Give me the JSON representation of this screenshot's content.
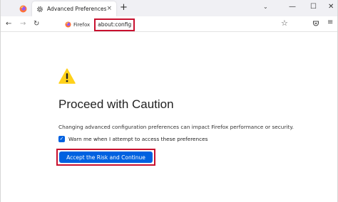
{
  "browser": {
    "tab": {
      "title": "Advanced Preferences",
      "close_glyph": "×"
    },
    "new_tab_glyph": "+",
    "tab_list_glyph": "⌄",
    "window_controls": {
      "minimize": "—",
      "maximize": "☐",
      "close": "✕"
    },
    "nav": {
      "back": "←",
      "forward": "→",
      "reload": "↻"
    },
    "identity_label": "Firefox",
    "url": "about:config",
    "bookmark_glyph": "☆",
    "menu_glyph": "≡"
  },
  "page": {
    "headline": "Proceed with Caution",
    "description": "Changing advanced configuration preferences can impact Firefox performance or security.",
    "checkbox_label": "Warn me when I attempt to access these preferences",
    "checkbox_checked": true,
    "checkbox_glyph": "✓",
    "accept_button": "Accept the Risk and Continue"
  },
  "colors": {
    "accent": "#0061e0",
    "highlight_outline": "#c8102e",
    "warning": "#ffd11a"
  }
}
